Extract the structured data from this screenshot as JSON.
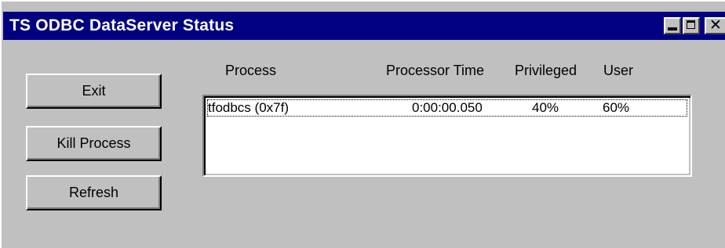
{
  "window": {
    "title": "TS ODBC DataServer Status",
    "caption_buttons": {
      "minimize_icon": "minimize-icon",
      "maximize_icon": "maximize-icon",
      "close_icon": "close-icon",
      "close_glyph": "✕"
    }
  },
  "buttons": {
    "exit": "Exit",
    "kill_process": "Kill Process",
    "refresh": "Refresh"
  },
  "table": {
    "headers": {
      "process": "Process",
      "processor_time": "Processor Time",
      "privileged": "Privileged",
      "user": "User"
    },
    "rows": [
      {
        "process": "tfodbcs (0x7f)",
        "processor_time": "0:00:00.050",
        "privileged": "40%",
        "user": "60%"
      }
    ]
  },
  "colors": {
    "titlebar": "#000080",
    "face": "#c0c0c0"
  }
}
